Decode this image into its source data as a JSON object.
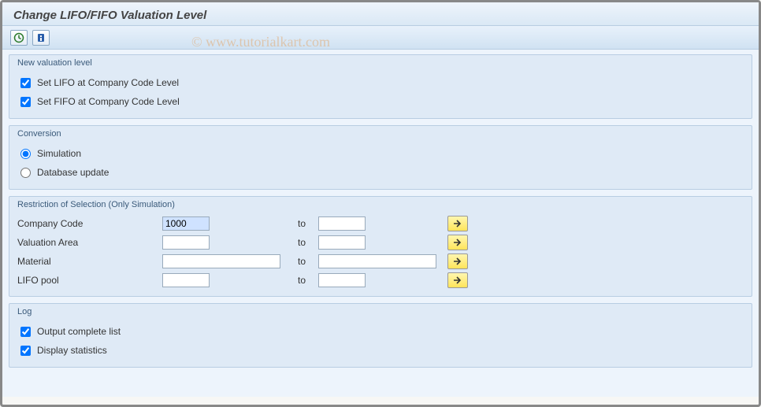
{
  "pageTitle": "Change LIFO/FIFO Valuation Level",
  "watermark": "© www.tutorialkart.com",
  "groups": {
    "newValuation": {
      "title": "New valuation level",
      "setLifo": "Set LIFO at Company Code Level",
      "setFifo": "Set FIFO at Company Code Level"
    },
    "conversion": {
      "title": "Conversion",
      "simulation": "Simulation",
      "databaseUpdate": "Database update"
    },
    "restriction": {
      "title": "Restriction of Selection (Only Simulation)",
      "to": "to",
      "companyCode": {
        "label": "Company Code",
        "from": "1000",
        "toVal": ""
      },
      "valuationArea": {
        "label": "Valuation Area",
        "from": "",
        "toVal": ""
      },
      "material": {
        "label": "Material",
        "from": "",
        "toVal": ""
      },
      "lifoPool": {
        "label": "LIFO pool",
        "from": "",
        "toVal": ""
      }
    },
    "log": {
      "title": "Log",
      "outputComplete": "Output complete list",
      "displayStats": "Display statistics"
    }
  }
}
